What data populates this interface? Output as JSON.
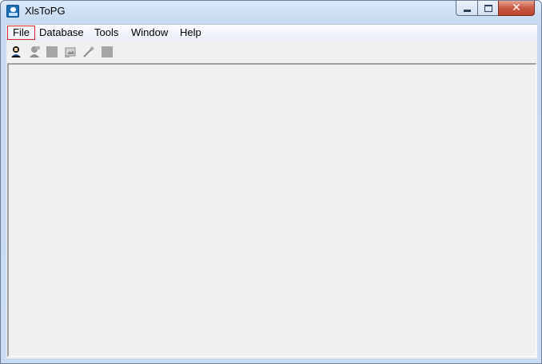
{
  "window": {
    "title": "XlsToPG"
  },
  "menu": {
    "items": [
      "File",
      "Database",
      "Tools",
      "Window",
      "Help"
    ]
  },
  "toolbar": {
    "buttons": [
      {
        "icon": "connect-user-icon",
        "enabled": true
      },
      {
        "icon": "disconnect-user-icon",
        "enabled": false
      },
      {
        "icon": "blank-square-icon",
        "enabled": false
      },
      {
        "icon": "table-image-icon",
        "enabled": false
      },
      {
        "icon": "wand-icon",
        "enabled": false
      },
      {
        "icon": "blank-square-icon",
        "enabled": false
      }
    ]
  },
  "colors": {
    "highlight_border": "#d3222a",
    "client_background": "#f0f0f0"
  }
}
